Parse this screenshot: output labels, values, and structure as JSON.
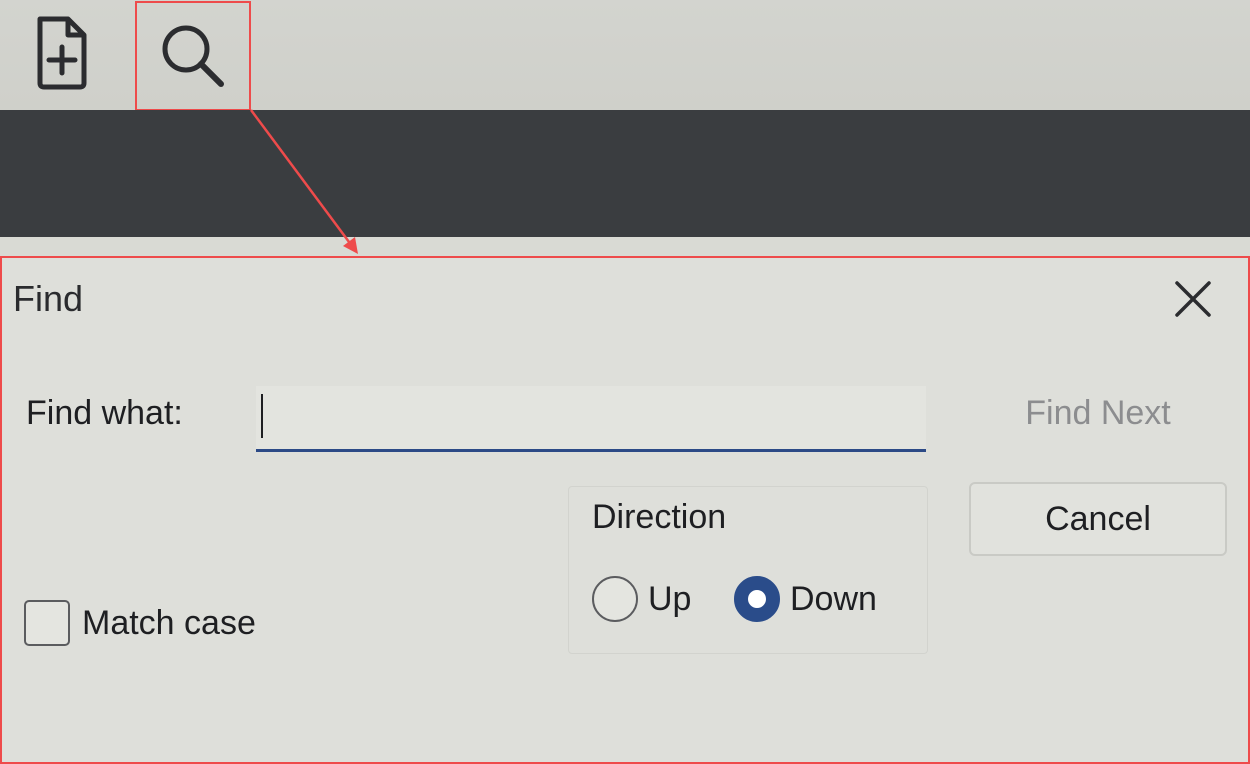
{
  "toolbar": {
    "new_file_icon": "file-plus-icon",
    "search_icon": "search-icon"
  },
  "dialog": {
    "title": "Find",
    "close_icon": "close-icon",
    "find_what_label": "Find what:",
    "find_what_value": "",
    "find_next_label": "Find Next",
    "cancel_label": "Cancel",
    "direction_label": "Direction",
    "direction_options": [
      {
        "label": "Up",
        "checked": false
      },
      {
        "label": "Down",
        "checked": true
      }
    ],
    "match_case_label": "Match case",
    "match_case_checked": false
  },
  "colors": {
    "highlight": "#ee4b4b",
    "accent": "#2a4c8a",
    "band": "#3a3d40",
    "disabled_text": "#8c8d8f"
  }
}
